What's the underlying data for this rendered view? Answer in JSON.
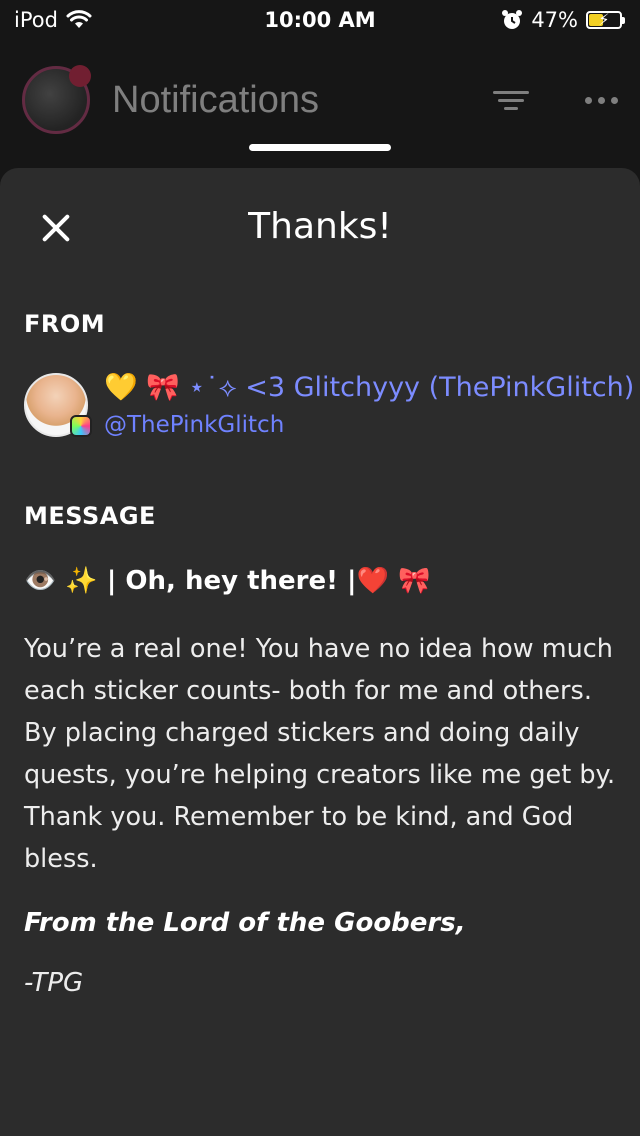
{
  "status_bar": {
    "carrier": "iPod",
    "time": "10:00 AM",
    "battery_percent": "47%",
    "battery_level": 0.47,
    "wifi_icon": "wifi-icon",
    "alarm_icon": "alarm-icon"
  },
  "app_header": {
    "title": "Notifications",
    "filter_icon": "filter-icon",
    "more_icon": "more-icon"
  },
  "sheet": {
    "title": "Thanks!",
    "close_icon": "close-icon",
    "from_label": "FROM",
    "sender": {
      "display_name": "💛 🎀 ⋆˙⟡ <3 Glitchyyy (ThePinkGlitch)",
      "handle": "@ThePinkGlitch"
    },
    "message_label": "MESSAGE",
    "message": {
      "greeting": "👁️ ✨ | Oh, hey there! |❤️ 🎀",
      "body": "You’re a real one! You have no idea how much each sticker counts- both for me and others. By placing charged stickers and doing daily quests, you’re helping creators like me get by. Thank you. Remember to be kind, and God bless.",
      "signoff": "From the Lord of the Goobers,",
      "initials": "-TPG"
    }
  },
  "colors": {
    "sheet_bg": "#2c2c2c",
    "page_bg": "#161616",
    "link_blue": "#7c8cff",
    "battery_yellow": "#f2d024"
  }
}
